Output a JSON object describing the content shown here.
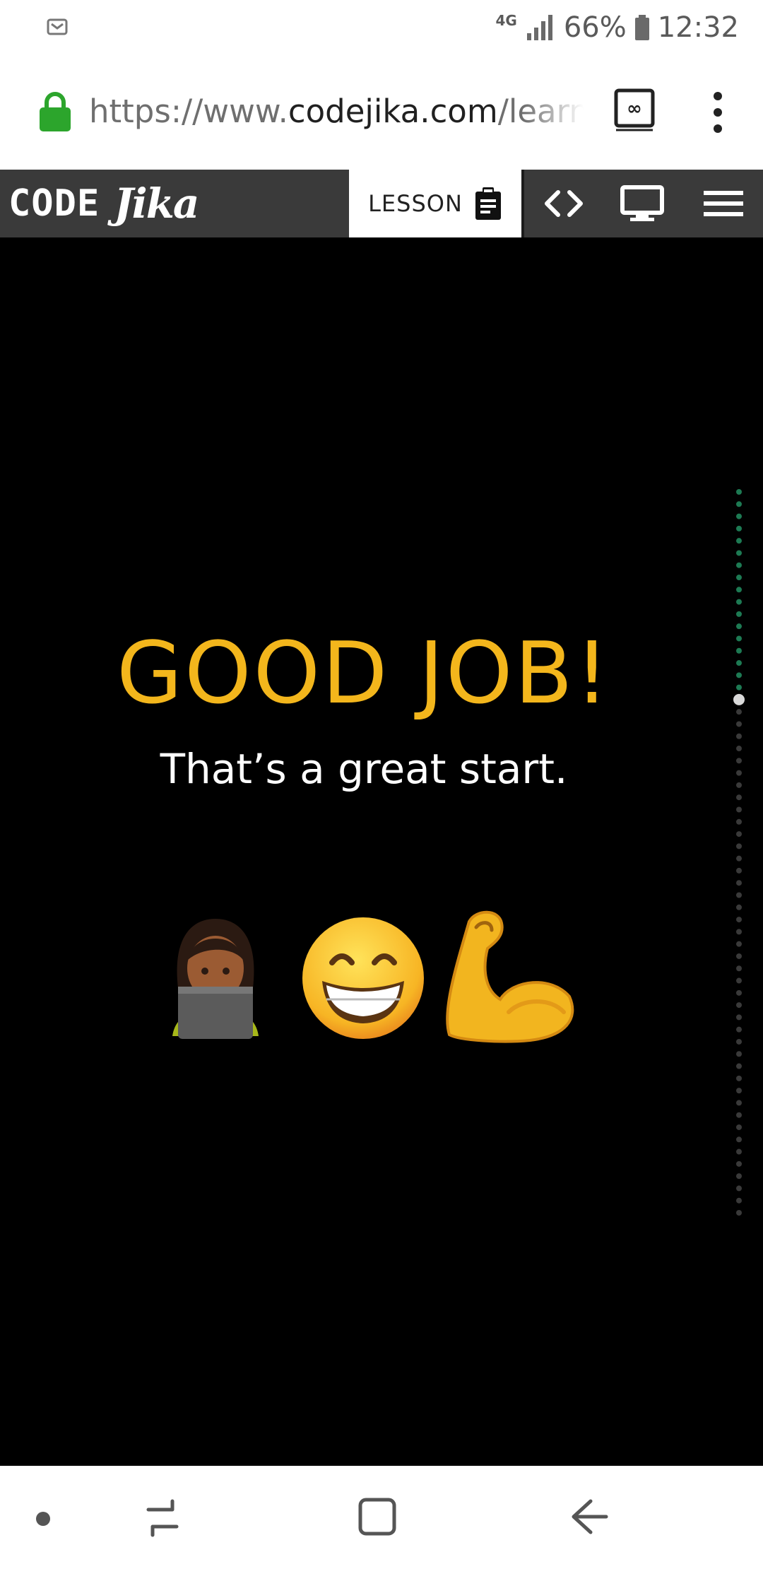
{
  "status_bar": {
    "network": "4G",
    "battery": "66%",
    "time": "12:32"
  },
  "browser": {
    "url_scheme": "https://www.",
    "url_host": "codejika.com",
    "url_path": "/learn",
    "tab_count_symbol": "∞"
  },
  "app_nav": {
    "logo_code": "CODE",
    "logo_jika": "Jika",
    "lesson_label": "LESSON",
    "icons": [
      "clipboard-icon",
      "code-icon",
      "screen-icon",
      "hamburger-icon"
    ]
  },
  "content": {
    "title": "GOOD JOB!",
    "subtitle": "That’s a great start.",
    "emojis": [
      "woman-technologist",
      "grinning-face-with-smiling-eyes",
      "flexed-biceps"
    ]
  },
  "progress": {
    "current_step_fraction": 0.28
  },
  "colors": {
    "accent_yellow": "#f3b61c",
    "nav_bg": "#3a3a3a",
    "lock_green": "#2ca52c",
    "progress_done": "#1d7a53",
    "progress_todo": "#3a3a3a",
    "progress_current": "#d9d9d9"
  }
}
